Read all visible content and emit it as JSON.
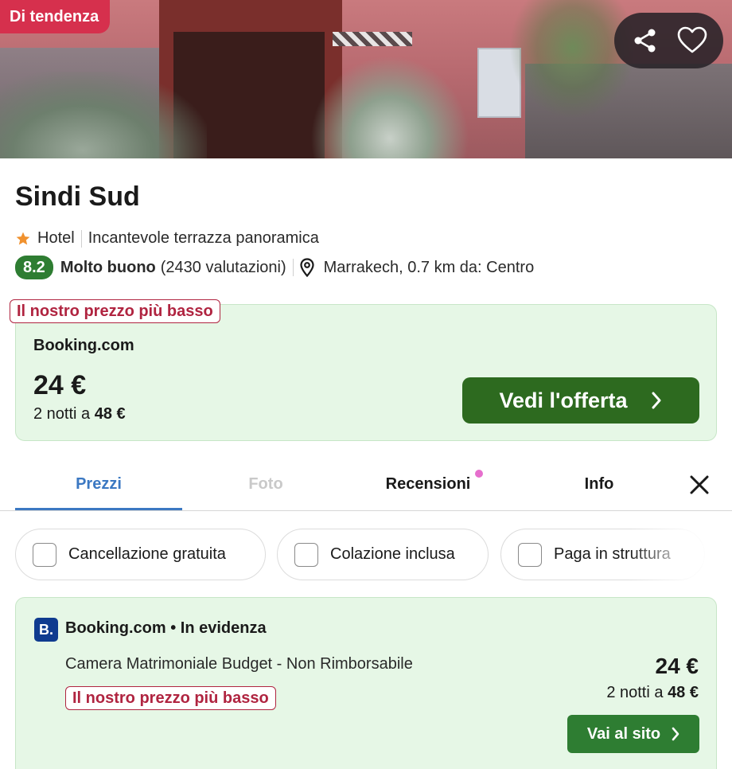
{
  "hero": {
    "badge": "Di tendenza",
    "icons": [
      "share-icon",
      "heart-icon"
    ]
  },
  "hotel": {
    "name": "Sindi Sud",
    "stars": 1,
    "type": "Hotel",
    "highlight": "Incantevole terrazza panoramica",
    "score": "8.2",
    "rating_label": "Molto buono",
    "rating_count": "(2430 valutazioni)",
    "location": "Marrakech, 0.7 km da: Centro"
  },
  "top_offer": {
    "tag": "Il nostro prezzo più basso",
    "provider": "Booking.com",
    "price": "24 €",
    "nights_prefix": "2 notti a",
    "nights_total": "48 €",
    "cta": "Vedi l'offerta"
  },
  "tabs": [
    {
      "label": "Prezzi",
      "state": "active"
    },
    {
      "label": "Foto",
      "state": "disabled"
    },
    {
      "label": "Recensioni",
      "state": "normal",
      "badge_dot": true
    },
    {
      "label": "Info",
      "state": "normal"
    }
  ],
  "filters": [
    {
      "label": "Cancellazione gratuita",
      "checked": false
    },
    {
      "label": "Colazione inclusa",
      "checked": false
    },
    {
      "label": "Paga in struttura",
      "checked": false
    }
  ],
  "deal": {
    "logo": "B.",
    "header": "Booking.com • In evidenza",
    "room": "Camera Matrimoniale Budget - Non Rimborsabile",
    "tag": "Il nostro prezzo più basso",
    "price": "24 €",
    "nights_prefix": "2 notti a",
    "nights_total": "48 €",
    "cta": "Vai al sito"
  },
  "colors": {
    "trend_badge": "#d6304d",
    "score": "#2e7d32",
    "cta_dark_green": "#2d6a1f",
    "offer_bg": "#e6f7e6",
    "tab_active": "#3b78c2",
    "lowest_tag": "#b02440",
    "notification_dot": "#e66fcd"
  }
}
